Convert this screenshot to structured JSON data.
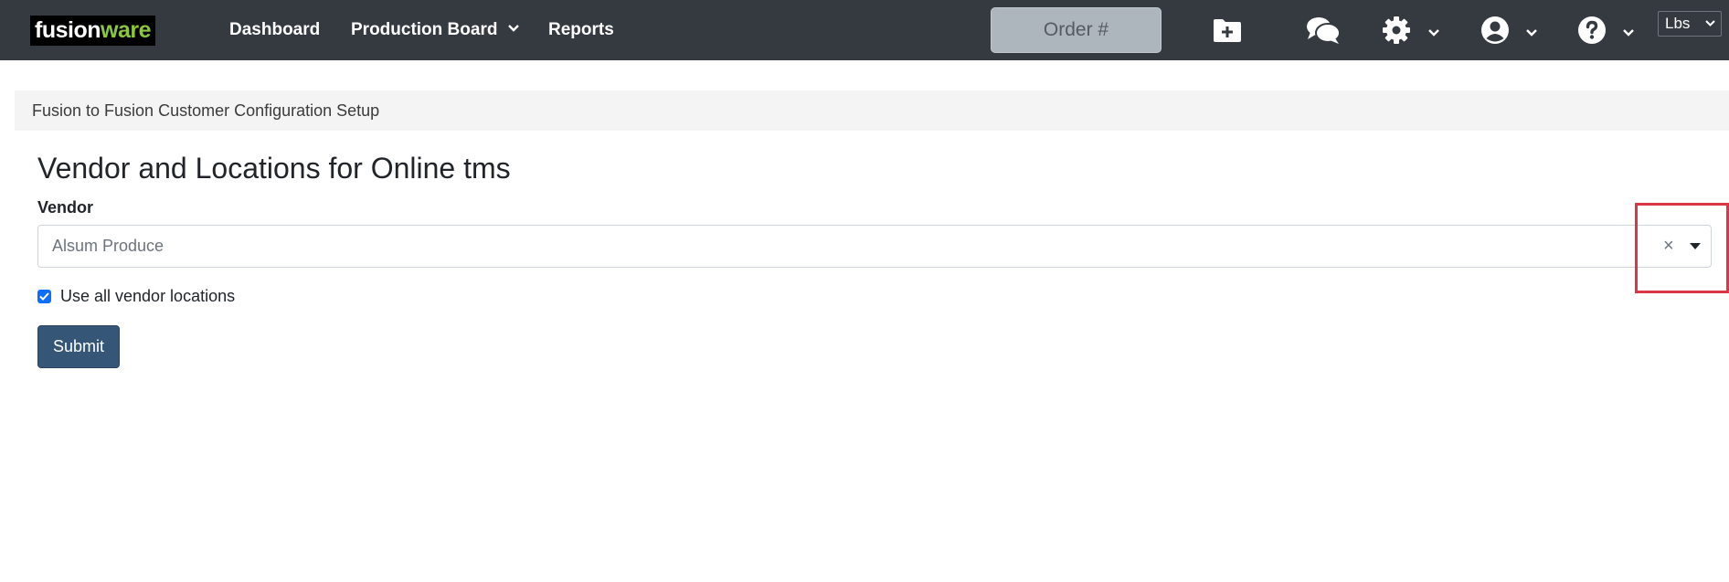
{
  "navbar": {
    "logo": {
      "part1": "fusion",
      "part2": "ware"
    },
    "links": [
      {
        "label": "Dashboard"
      },
      {
        "label": "Production Board"
      },
      {
        "label": "Reports"
      }
    ],
    "order_placeholder": "Order #",
    "icons": [
      "folder-plus-icon",
      "chat-bubbles-icon",
      "gear-icon",
      "user-circle-icon",
      "question-circle-icon"
    ],
    "units": {
      "selected": "Lbs"
    }
  },
  "breadcrumb": {
    "text": "Fusion to Fusion Customer Configuration Setup"
  },
  "main": {
    "title": "Vendor and Locations for Online tms",
    "vendor_label": "Vendor",
    "vendor_value": "Alsum Produce",
    "clear_symbol": "×",
    "checkbox": {
      "label": "Use all vendor locations",
      "checked": true
    },
    "submit_label": "Submit"
  },
  "colors": {
    "navbar_bg": "#343a40",
    "logo_accent": "#8cc63f",
    "submit_bg": "#365678",
    "highlight": "#dc3545",
    "checkbox": "#0d6efd"
  }
}
